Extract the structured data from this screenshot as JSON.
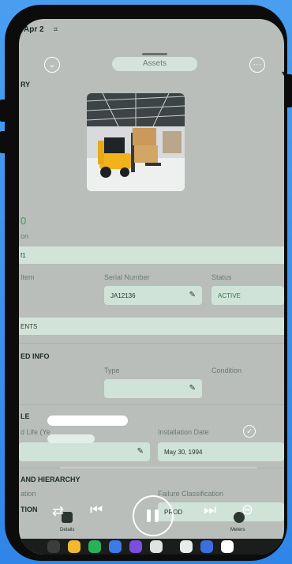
{
  "status": {
    "time": "Apr 2"
  },
  "header": {
    "title": "Assets"
  },
  "sections": {
    "summary_label": "RY",
    "sub_label": "on",
    "band1": "f1",
    "band2": "ENTS",
    "band3_title": "ED INFO",
    "band4_title": "LE",
    "band5_title": "AND HIERARCHY",
    "orphan_digit": "0"
  },
  "fields": {
    "item_label": "Item",
    "serial_label": "Serial Number",
    "serial_value": "JA12136",
    "status_label": "Status",
    "status_value": "ACTIVE",
    "type_label": "Type",
    "condition_label": "Condition",
    "life_label": "d Life (Ye",
    "install_label": "Installation Date",
    "install_value": "May 30, 1994",
    "location_label": "ation",
    "location_value": "TION",
    "failure_label": "Failure Classification",
    "failure_value": "PROD"
  },
  "nav": {
    "details": "Details",
    "meters": "Meters"
  },
  "colors": {
    "accent": "#d2e3da",
    "status_active": "#2e7a46"
  }
}
